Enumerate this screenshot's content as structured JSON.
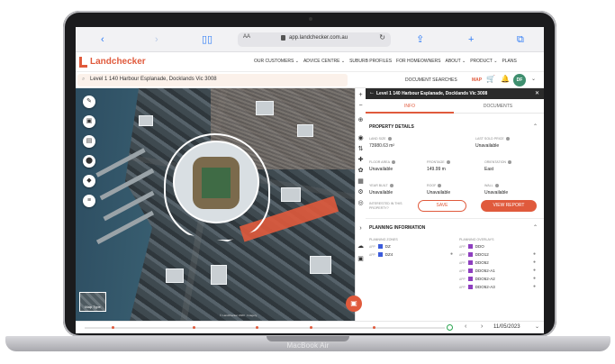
{
  "device": {
    "model": "MacBook Air"
  },
  "browser": {
    "text_size": "AA",
    "url": "app.landchecker.com.au"
  },
  "site": {
    "logo": "Landchecker",
    "nav": [
      "OUR CUSTOMERS ⌄",
      "ADVICE CENTRE ⌄",
      "SUBURB PROFILES",
      "FOR HOMEOWNERS",
      "ABOUT ⌄",
      "PRODUCT ⌄",
      "PLANS"
    ],
    "search_value": "Level 1 140 Harbour Esplanade, Docklands Vic 3008",
    "document_searches": "DOCUMENT SEARCHES",
    "map_link": "MAP",
    "avatar_initials": "DF"
  },
  "map": {
    "type_label": "Map Type",
    "attribution": "© Landchecker 2023 · Imagery"
  },
  "panel": {
    "title": "Level 1 140 Harbour Esplanade, Docklands Vic 3008",
    "tabs": [
      "INFO",
      "DOCUMENTS"
    ],
    "property_details": {
      "heading": "PROPERTY DETAILS",
      "fields": [
        {
          "label": "LAND SIZE",
          "value": "73980.63 m²"
        },
        {
          "label": "LAST SOLD PRICE",
          "value": "Unavailable"
        },
        {
          "label": "FLOOR AREA",
          "value": "Unavailable"
        },
        {
          "label": "FRONTAGE",
          "value": "149.99 m"
        },
        {
          "label": "ORIENTATION",
          "value": "East"
        },
        {
          "label": "YEAR BUILT",
          "value": "Unavailable"
        },
        {
          "label": "ROOF",
          "value": "Unavailable"
        },
        {
          "label": "WALL",
          "value": "Unavailable"
        }
      ],
      "interested": "INTERESTED IN THIS PROPERTY?",
      "save_label": "SAVE",
      "report_label": "VIEW REPORT"
    },
    "planning": {
      "heading": "PLANNING INFORMATION",
      "zones_label": "PLANNING ZONES",
      "overlays_label": "PLANNING OVERLAYS",
      "zones": [
        {
          "apr": "APP",
          "code": "DZ",
          "color": "#3b5bdb"
        },
        {
          "apr": "APP",
          "code": "DZ4",
          "color": "#3b5bdb"
        }
      ],
      "overlays": [
        {
          "apr": "APP",
          "code": "DDO",
          "color": "#8e3fbf"
        },
        {
          "apr": "APP",
          "code": "DDO12",
          "color": "#8e3fbf"
        },
        {
          "apr": "APP",
          "code": "DDO52",
          "color": "#8e3fbf"
        },
        {
          "apr": "APP",
          "code": "DDO52-A1",
          "color": "#8e3fbf"
        },
        {
          "apr": "APP",
          "code": "DDO52-A2",
          "color": "#8e3fbf"
        },
        {
          "apr": "APP",
          "code": "DDO52-A3",
          "color": "#8e3fbf"
        }
      ]
    }
  },
  "timeline": {
    "date": "11/05/2023"
  },
  "colors": {
    "accent": "#e05a3c",
    "dark": "#2b2b2b"
  }
}
